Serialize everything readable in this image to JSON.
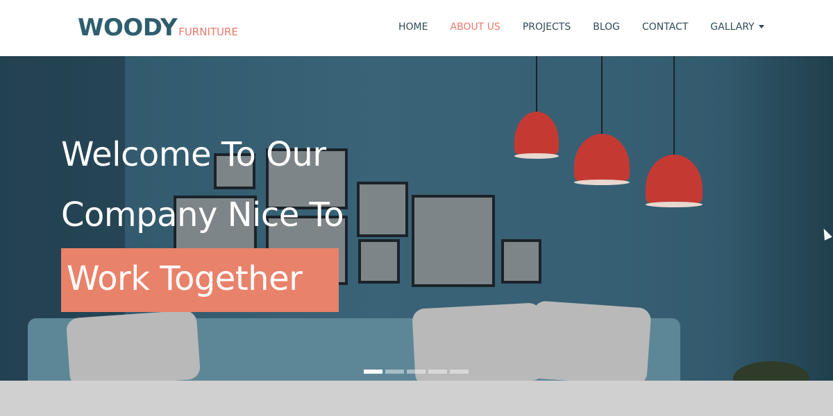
{
  "logo": {
    "main": "WOODY",
    "sub": "FURNITURE"
  },
  "nav": {
    "items": [
      {
        "label": "HOME",
        "active": false
      },
      {
        "label": "ABOUT US",
        "active": true
      },
      {
        "label": "PROJECTS",
        "active": false
      },
      {
        "label": "BLOG",
        "active": false
      },
      {
        "label": "CONTACT",
        "active": false
      },
      {
        "label": "GALLARY",
        "active": false,
        "dropdown": true
      }
    ]
  },
  "hero": {
    "line1": "Welcome To Our",
    "line2": "Company Nice To",
    "highlight": "Work Together"
  },
  "carousel": {
    "slides": 5,
    "active_index": 0
  },
  "colors": {
    "brand": "#2e5e6e",
    "accent": "#e7796a",
    "highlight_bg": "#e9826a",
    "hero_bg": "#3a6377",
    "lamp": "#c43a33"
  },
  "icons": {
    "dropdown": "caret-down-icon",
    "cursor": "mouse-pointer-icon"
  }
}
